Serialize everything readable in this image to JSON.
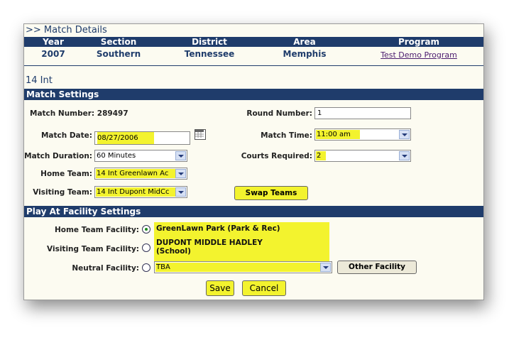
{
  "header": {
    "title": ">> Match Details",
    "columns": [
      "Year",
      "Section",
      "District",
      "Area",
      "Program"
    ],
    "values": [
      "2007",
      "Southern",
      "Tennessee",
      "Memphis"
    ],
    "program_link": "Test Demo Program"
  },
  "subtitle": "14 Int",
  "match_settings": {
    "section_title": "Match Settings",
    "match_number_label": "Match Number:",
    "match_number": "289497",
    "round_number_label": "Round Number:",
    "round_number": "1",
    "match_date_label": "Match Date:",
    "match_date": "08/27/2006",
    "match_time_label": "Match Time:",
    "match_time": "11:00 am",
    "duration_label": "Match Duration:",
    "duration": "60 Minutes",
    "courts_label": "Courts Required:",
    "courts": "2",
    "home_team_label": "Home Team:",
    "home_team": "14 Int Greenlawn Ac",
    "visiting_team_label": "Visiting Team:",
    "visiting_team": "14 Int Dupont MidCc",
    "swap_label": "Swap Teams"
  },
  "facility": {
    "section_title": "Play At Facility Settings",
    "home_label": "Home Team Facility:",
    "home_name": "GreenLawn Park (Park & Rec)",
    "visiting_label": "Visiting Team Facility:",
    "visiting_name_line1": "DUPONT MIDDLE HADLEY",
    "visiting_name_line2": "(School)",
    "neutral_label": "Neutral Facility:",
    "neutral_value": "TBA",
    "other_button": "Other Facility"
  },
  "actions": {
    "save": "Save",
    "cancel": "Cancel"
  },
  "colors": {
    "header_bar": "#1f3c6b",
    "highlight": "#f3f32e",
    "link": "#4b1b6e",
    "panel_bg": "#fcfbf1"
  }
}
